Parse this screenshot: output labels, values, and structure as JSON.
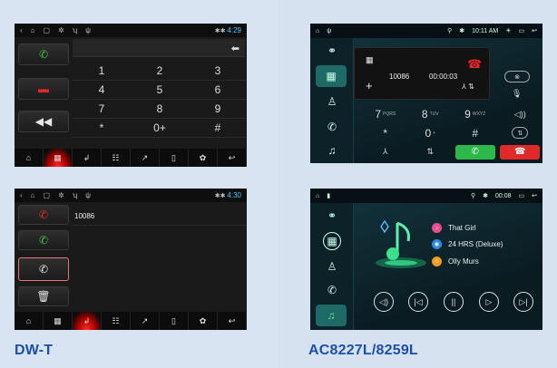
{
  "colors": {
    "accent_green": "#3ec24a",
    "accent_red": "#e8262b",
    "brand_blue": "#1d4fa8",
    "ac_teal": "#1d6a66"
  },
  "left_panel": {
    "brand": "DW-T",
    "screen1": {
      "time": "4:29",
      "keys": [
        "1",
        "2",
        "3",
        "4",
        "5",
        "6",
        "7",
        "8",
        "9",
        "*",
        "0+",
        "#"
      ]
    },
    "screen2": {
      "time": "4:30",
      "entry": "10086"
    }
  },
  "right_panel": {
    "brand": "AC8227L/8259L",
    "screen1": {
      "time": "10:11 AM",
      "number": "10086",
      "timer": "00:00:03",
      "keys": [
        {
          "main": "7",
          "sub": "PQRS"
        },
        {
          "main": "8",
          "sub": "TUV"
        },
        {
          "main": "9",
          "sub": "WXYZ"
        },
        {
          "main": "*",
          "sub": ""
        },
        {
          "main": "0",
          "sub": "+"
        },
        {
          "main": "#",
          "sub": ""
        }
      ]
    },
    "screen2": {
      "time": "00:08",
      "tracks": [
        "That Girl",
        "24 HRS (Deluxe)",
        "Olly Murs"
      ]
    }
  }
}
